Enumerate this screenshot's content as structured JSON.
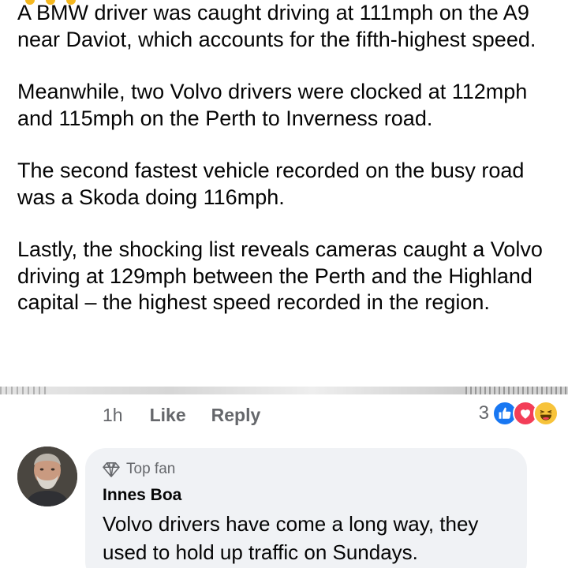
{
  "post": {
    "paragraphs": [
      "A BMW driver was caught driving at 111mph on the A9 near Daviot, which accounts for the fifth-highest speed.",
      "Meanwhile, two Volvo drivers were clocked at 112mph and 115mph on the Perth to Inverness road.",
      "The second fastest vehicle recorded on the busy road was a Skoda doing 116mph.",
      "Lastly, the shocking list reveals cameras caught a Volvo driving at 129mph between the Perth and the Highland capital – the highest speed recorded in the region."
    ]
  },
  "actions": {
    "time": "1h",
    "like_label": "Like",
    "reply_label": "Reply"
  },
  "reactions": {
    "count": "3",
    "icons": [
      "like-icon",
      "love-icon",
      "haha-icon"
    ],
    "colors": {
      "like": "#1877f2",
      "love": "#f33e58",
      "haha": "#f7c33b"
    }
  },
  "comment": {
    "badge": "Top fan",
    "badge_icon": "diamond-icon",
    "author": "Innes Boa",
    "text": "Volvo drivers have come a long way, they used to hold up traffic on Sundays."
  },
  "colors": {
    "text": "#050505",
    "secondary": "#65676b",
    "bubble": "#f0f2f5"
  }
}
